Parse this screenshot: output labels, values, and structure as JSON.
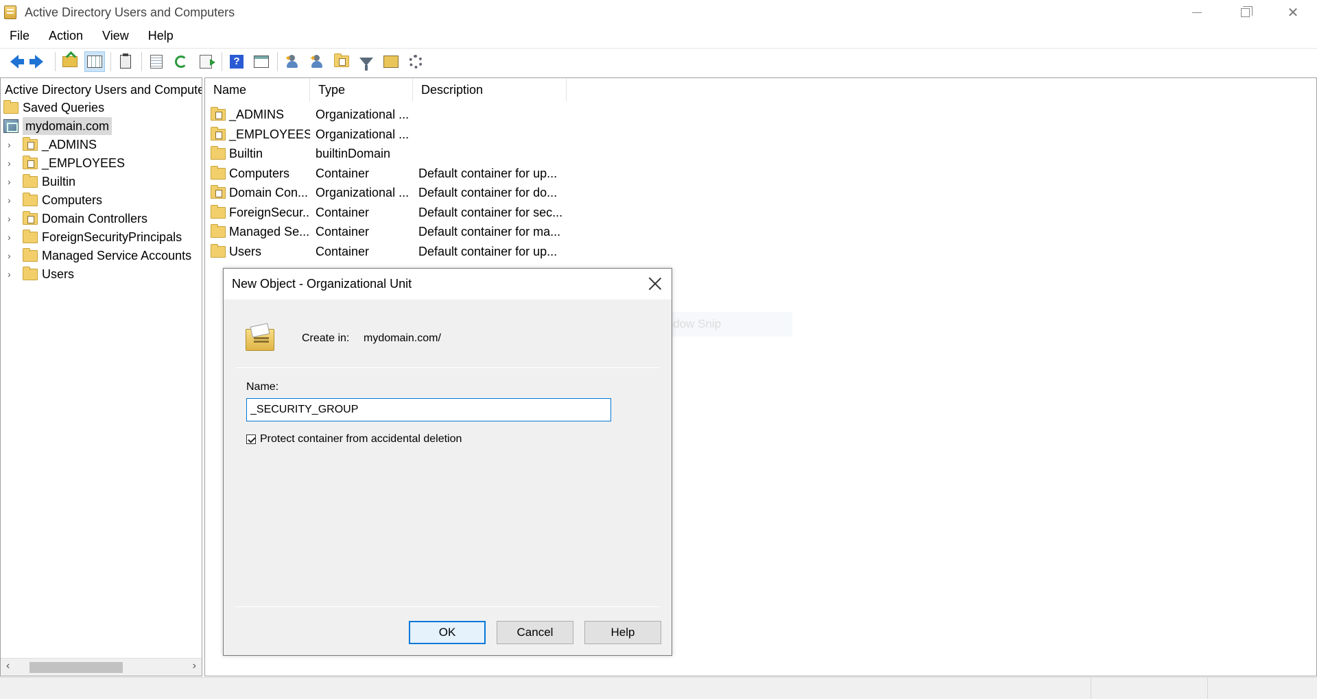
{
  "window": {
    "title": "Active Directory Users and Computers"
  },
  "menu": [
    "File",
    "Action",
    "View",
    "Help"
  ],
  "toolbar": {
    "icons": [
      "back-arrow-icon",
      "forward-arrow-icon",
      "folder-up-icon",
      "console-tree-icon",
      "clipboard-icon",
      "properties-icon",
      "refresh-icon",
      "export-list-icon",
      "help-icon",
      "action-pane-icon",
      "new-user-icon",
      "new-group-icon",
      "new-ou-icon",
      "filter-icon",
      "find-icon",
      "delegate-icon"
    ]
  },
  "tree": {
    "root": "Active Directory Users and Computer",
    "saved_queries": "Saved Queries",
    "domain": "mydomain.com",
    "children": [
      {
        "label": "_ADMINS",
        "kind": "ou"
      },
      {
        "label": "_EMPLOYEES",
        "kind": "ou"
      },
      {
        "label": "Builtin",
        "kind": "container"
      },
      {
        "label": "Computers",
        "kind": "container"
      },
      {
        "label": "Domain Controllers",
        "kind": "ou"
      },
      {
        "label": "ForeignSecurityPrincipals",
        "kind": "container"
      },
      {
        "label": "Managed Service Accounts",
        "kind": "container"
      },
      {
        "label": "Users",
        "kind": "container"
      }
    ]
  },
  "list": {
    "columns": [
      "Name",
      "Type",
      "Description"
    ],
    "rows": [
      {
        "name": "_ADMINS",
        "type": "Organizational ...",
        "description": "",
        "kind": "ou"
      },
      {
        "name": "_EMPLOYEES",
        "type": "Organizational ...",
        "description": "",
        "kind": "ou"
      },
      {
        "name": "Builtin",
        "type": "builtinDomain",
        "description": "",
        "kind": "container"
      },
      {
        "name": "Computers",
        "type": "Container",
        "description": "Default container for up...",
        "kind": "container"
      },
      {
        "name": "Domain Con...",
        "type": "Organizational ...",
        "description": "Default container for do...",
        "kind": "ou"
      },
      {
        "name": "ForeignSecur...",
        "type": "Container",
        "description": "Default container for sec...",
        "kind": "container"
      },
      {
        "name": "Managed Se...",
        "type": "Container",
        "description": "Default container for ma...",
        "kind": "container"
      },
      {
        "name": "Users",
        "type": "Container",
        "description": "Default container for up...",
        "kind": "container"
      }
    ]
  },
  "ghost_tooltip": {
    "label": "Window Snip"
  },
  "dialog": {
    "title": "New Object - Organizational Unit",
    "create_in_label": "Create in:",
    "create_in_value": "mydomain.com/",
    "name_label": "Name:",
    "name_value": "_SECURITY_GROUP",
    "protect_label": "Protect container from accidental deletion",
    "protect_checked": true,
    "ok_label": "OK",
    "cancel_label": "Cancel",
    "help_label": "Help"
  },
  "colors": {
    "accent": "#0078d7",
    "selection": "#d9d9d9",
    "folder": "#f2cf6a"
  }
}
